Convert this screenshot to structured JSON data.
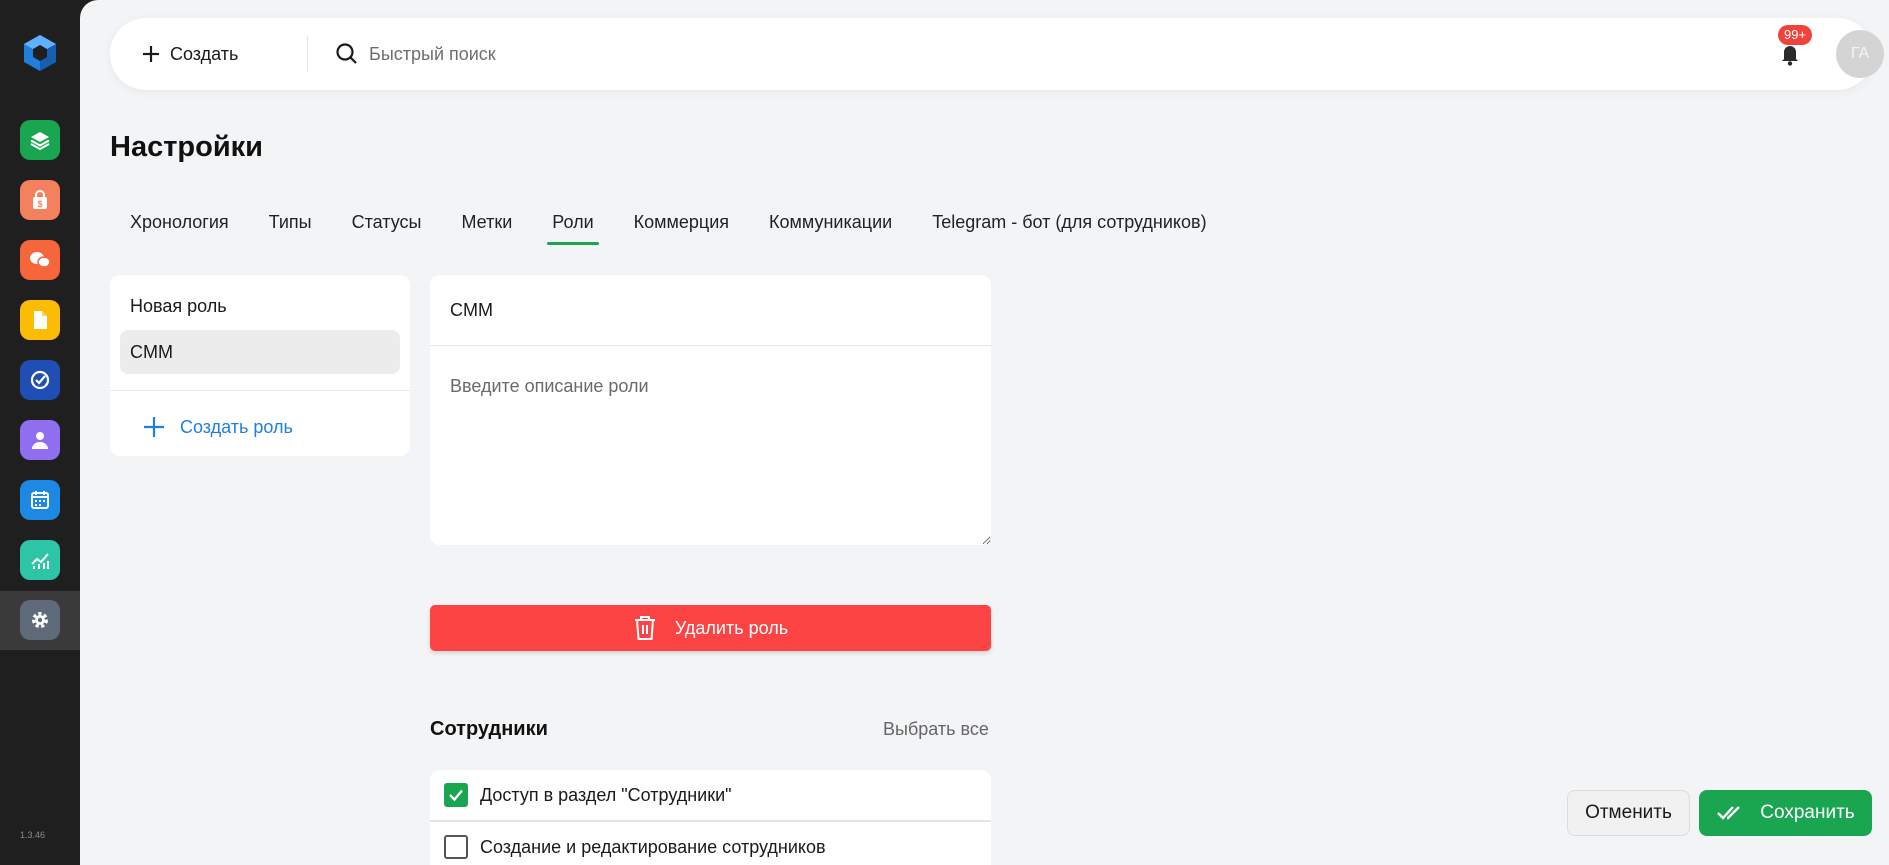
{
  "app": {
    "version": "1.3.46"
  },
  "sidebar": {
    "items": [
      {
        "name": "layers-icon",
        "color": "#1aa551"
      },
      {
        "name": "shopping-bag-icon",
        "color": "#f4805e"
      },
      {
        "name": "chat-bubbles-icon",
        "color": "#f5663b"
      },
      {
        "name": "document-icon",
        "color": "#fbbc05"
      },
      {
        "name": "check-circle-icon",
        "color": "#1f4fb5"
      },
      {
        "name": "user-icon",
        "color": "#8f6ff0"
      },
      {
        "name": "calendar-icon",
        "color": "#1e88e5"
      },
      {
        "name": "analytics-icon",
        "color": "#2ec4a6"
      },
      {
        "name": "settings-gear-icon",
        "color": "#5f6b7a"
      }
    ],
    "active_index": 8
  },
  "header": {
    "create_label": "Создать",
    "search_placeholder": "Быстрый поиск",
    "notifications_badge": "99+",
    "avatar_initials": "ГА"
  },
  "page": {
    "title": "Настройки"
  },
  "tabs": [
    {
      "label": "Хронология"
    },
    {
      "label": "Типы"
    },
    {
      "label": "Статусы"
    },
    {
      "label": "Метки"
    },
    {
      "label": "Роли",
      "active": true
    },
    {
      "label": "Коммерция"
    },
    {
      "label": "Коммуникации"
    },
    {
      "label": "Telegram - бот (для сотрудников)"
    }
  ],
  "roles": {
    "items": [
      {
        "label": "Новая роль"
      },
      {
        "label": "CMM",
        "selected": true
      }
    ],
    "create_label": "Создать роль"
  },
  "editor": {
    "role_name": "CMM",
    "description_placeholder": "Введите описание роли",
    "delete_label": "Удалить роль"
  },
  "permissions": {
    "title": "Сотрудники",
    "select_all_label": "Выбрать все",
    "items": [
      {
        "label": "Доступ в раздел \"Сотрудники\"",
        "checked": true
      },
      {
        "label": "Создание и редактирование сотрудников",
        "checked": false
      }
    ]
  },
  "footer": {
    "cancel_label": "Отменить",
    "save_label": "Сохранить"
  },
  "colors": {
    "accent": "#1aa551",
    "danger": "#fd4444",
    "link": "#1e7fdc",
    "badge": "#f0433a"
  }
}
